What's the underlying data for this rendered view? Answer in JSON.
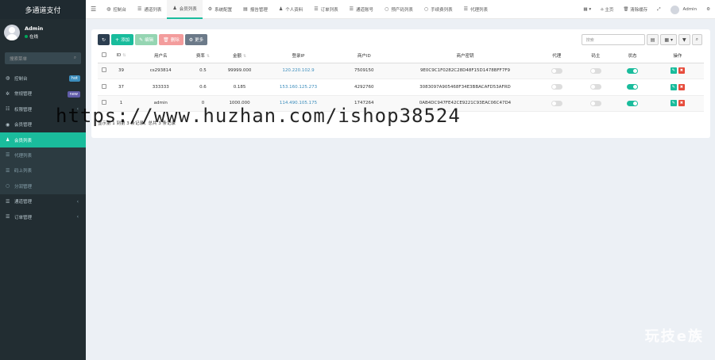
{
  "app": {
    "title": "多通道支付"
  },
  "user": {
    "name": "Admin",
    "status": "在线"
  },
  "sidebar": {
    "search_placeholder": "搜索菜单",
    "items": [
      {
        "label": "控制台",
        "icon": "dashboard-icon",
        "badge": "hot",
        "badge_color": "#3c8dbc"
      },
      {
        "label": "常规管理",
        "icon": "cogs-icon",
        "badge": "new",
        "badge_color": "#605ca8"
      },
      {
        "label": "权限管理",
        "icon": "group-icon",
        "arrow": "‹"
      },
      {
        "label": "会员管理",
        "icon": "user-circle-icon"
      },
      {
        "label": "会员列表",
        "icon": "user-icon",
        "active": true
      },
      {
        "label": "代理列表",
        "icon": "list-icon",
        "sub": true
      },
      {
        "label": "码上列表",
        "icon": "list-icon",
        "sub": true
      },
      {
        "label": "分润管理",
        "icon": "circle-icon",
        "sub": true
      },
      {
        "label": "通道管理",
        "icon": "list-icon",
        "arrow": "‹"
      },
      {
        "label": "订单管理",
        "icon": "list-icon",
        "arrow": "‹"
      }
    ]
  },
  "topbar": {
    "tabs": [
      {
        "label": "控制台",
        "icon": "dashboard-icon"
      },
      {
        "label": "通道列表",
        "icon": "list-icon"
      },
      {
        "label": "会员列表",
        "icon": "user-icon",
        "active": true
      },
      {
        "label": "系统配置",
        "icon": "cog-icon"
      },
      {
        "label": "报告管理",
        "icon": "file-icon"
      },
      {
        "label": "个人资料",
        "icon": "user-icon"
      },
      {
        "label": "订单列表",
        "icon": "list-icon"
      },
      {
        "label": "通道账号",
        "icon": "list-icon"
      },
      {
        "label": "预产码列表",
        "icon": "circle-icon"
      },
      {
        "label": "手续费列表",
        "icon": "circle-icon"
      },
      {
        "label": "代理列表",
        "icon": "list-icon"
      }
    ],
    "right": {
      "home": "主页",
      "clear_cache": "清除缓存",
      "admin": "Admin"
    }
  },
  "toolbar": {
    "refresh_icon": "refresh-icon",
    "add": "添加",
    "edit": "编辑",
    "delete": "删除",
    "more": "更多",
    "search_placeholder": "搜索"
  },
  "table": {
    "headers": [
      "",
      "ID",
      "用户名",
      "费率",
      "金额",
      "登录IP",
      "商户ID",
      "商户密钥",
      "代理",
      "码主",
      "状态",
      "操作"
    ],
    "rows": [
      {
        "id": "39",
        "username": "cs293814",
        "rate": "0.5",
        "amount": "99999.000",
        "ip": "120.220.102.9",
        "merchant_id": "7509150",
        "key": "9E0C9C1F0282C28D48F15D1478BFF7F9",
        "agent": false,
        "coder": false,
        "status": true
      },
      {
        "id": "37",
        "username": "333333",
        "rate": "0.6",
        "amount": "0.185",
        "ip": "153.160.125.273",
        "merchant_id": "4292760",
        "key": "3083097A905468F34E3BBACAFD53AFRD",
        "agent": false,
        "coder": false,
        "status": true
      },
      {
        "id": "1",
        "username": "admin",
        "rate": "0",
        "amount": "1000.000",
        "ip": "114.490.105.175",
        "merchant_id": "1747264",
        "key": "0AB4DC947FE42CE9221C93EAC06C47D4",
        "agent": false,
        "coder": false,
        "status": true
      }
    ]
  },
  "pagination": {
    "text": "显示第 1 到第 3 条记录，总共 3 条记录"
  },
  "watermark": {
    "text": "https://www.huzhan.com/ishop38524",
    "brand": "玩技e族"
  },
  "colors": {
    "accent": "#1abc9c",
    "add": "#18bc9c",
    "edit": "#95d5b2",
    "delete": "#f39c9c",
    "more": "#6c7a89",
    "refresh": "#2c3e50"
  }
}
